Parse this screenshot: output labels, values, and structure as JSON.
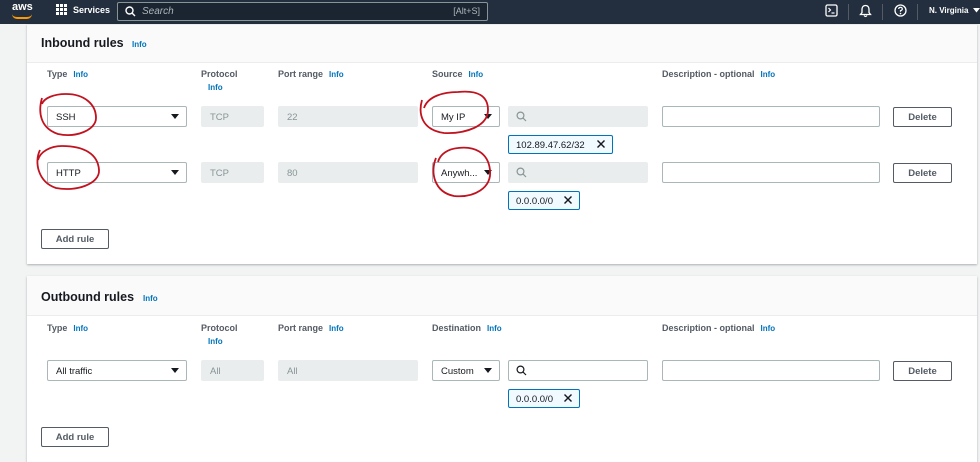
{
  "nav": {
    "logo": "aws",
    "services": "Services",
    "search_placeholder": "Search",
    "search_shortcut": "[Alt+S]",
    "region": "N. Virginia"
  },
  "icons": [
    "grid-icon",
    "search-icon",
    "cloudshell-icon",
    "bell-icon",
    "help-icon",
    "chevron-down-icon",
    "close-icon"
  ],
  "colors": {
    "nav_bg": "#232f3e",
    "accent_orange": "#ff9900",
    "link_blue": "#0073bb",
    "annotation_red": "#c1121f"
  },
  "inbound": {
    "title": "Inbound rules",
    "info": "Info",
    "columns": {
      "type": "Type",
      "protocol": "Protocol",
      "port_range": "Port range",
      "source": "Source",
      "description": "Description - optional",
      "info": "Info"
    },
    "rows": [
      {
        "type": "SSH",
        "protocol": "TCP",
        "port_range": "22",
        "source": "My IP",
        "token": "102.89.47.62/32",
        "delete": "Delete"
      },
      {
        "type": "HTTP",
        "protocol": "TCP",
        "port_range": "80",
        "source": "Anywh...",
        "token": "0.0.0.0/0",
        "delete": "Delete"
      }
    ],
    "add_rule": "Add rule"
  },
  "outbound": {
    "title": "Outbound rules",
    "info": "Info",
    "columns": {
      "type": "Type",
      "protocol": "Protocol",
      "port_range": "Port range",
      "destination": "Destination",
      "description": "Description - optional",
      "info": "Info"
    },
    "rows": [
      {
        "type": "All traffic",
        "protocol": "All",
        "port_range": "All",
        "destination": "Custom",
        "token": "0.0.0.0/0",
        "delete": "Delete"
      }
    ],
    "add_rule": "Add rule"
  }
}
